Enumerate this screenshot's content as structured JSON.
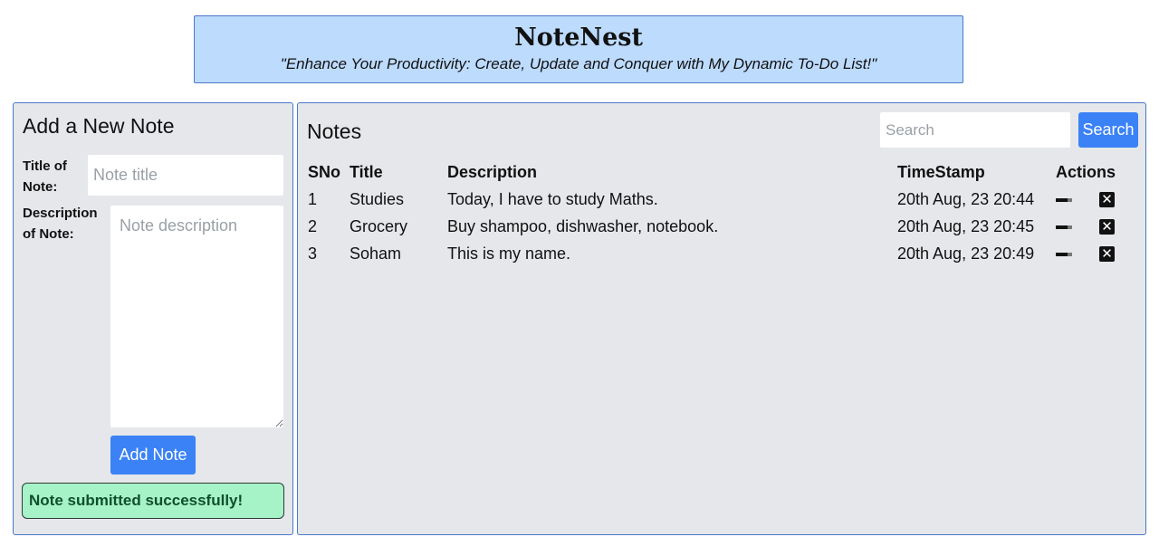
{
  "header": {
    "title": "NoteNest",
    "tagline": "\"Enhance Your Productivity: Create, Update and Conquer with My Dynamic To-Do List!\""
  },
  "add_note": {
    "heading": "Add a New Note",
    "title_label": "Title of Note:",
    "title_placeholder": "Note title",
    "desc_label": "Description of Note:",
    "desc_placeholder": "Note description",
    "add_button": "Add Note",
    "success_message": "Note submitted successfully!"
  },
  "notes": {
    "heading": "Notes",
    "search_placeholder": "Search",
    "search_button": "Search",
    "columns": {
      "sno": "SNo",
      "title": "Title",
      "description": "Description",
      "timestamp": "TimeStamp",
      "actions": "Actions"
    },
    "rows": [
      {
        "sno": "1",
        "title": "Studies",
        "description": "Today, I have to study Maths.",
        "timestamp": "20th Aug, 23 20:44"
      },
      {
        "sno": "2",
        "title": "Grocery",
        "description": "Buy shampoo, dishwasher, notebook.",
        "timestamp": "20th Aug, 23 20:45"
      },
      {
        "sno": "3",
        "title": "Soham",
        "description": "This is my name.",
        "timestamp": "20th Aug, 23 20:49"
      }
    ],
    "action_icons": [
      "edit-icon",
      "delete-icon"
    ],
    "delete_glyph": "✕"
  },
  "colors": {
    "header_bg": "#bddbfd",
    "panel_bg": "#e5e7eb",
    "border": "#4a78c9",
    "primary_button": "#3b82f6",
    "success_bg": "#a7f3c8"
  }
}
